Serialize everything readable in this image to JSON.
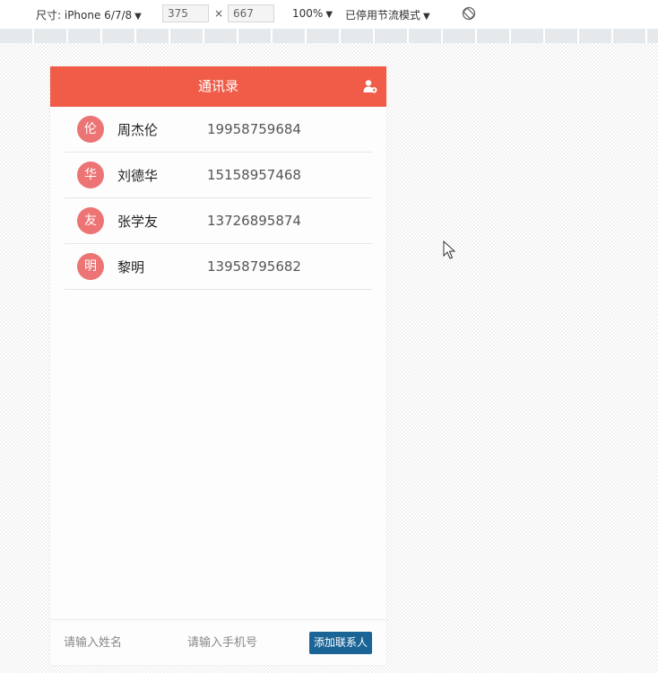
{
  "devtools": {
    "device_label": "尺寸: iPhone 6/7/8",
    "width_value": "375",
    "times_symbol": "×",
    "height_value": "667",
    "zoom": "100%",
    "throttle": "已停用节流模式",
    "caret": "▼"
  },
  "app": {
    "title": "通讯录",
    "contacts": [
      {
        "avatar": "伦",
        "name": "周杰伦",
        "phone": "19958759684"
      },
      {
        "avatar": "华",
        "name": "刘德华",
        "phone": "15158957468"
      },
      {
        "avatar": "友",
        "name": "张学友",
        "phone": "13726895874"
      },
      {
        "avatar": "明",
        "name": "黎明",
        "phone": "13958795682"
      }
    ],
    "footer": {
      "name_placeholder": "请输入姓名",
      "phone_placeholder": "请输入手机号",
      "add_label": "添加联系人"
    }
  },
  "colors": {
    "header": "#f05c48",
    "avatar": "#ec7474",
    "add_button": "#1a6496"
  }
}
